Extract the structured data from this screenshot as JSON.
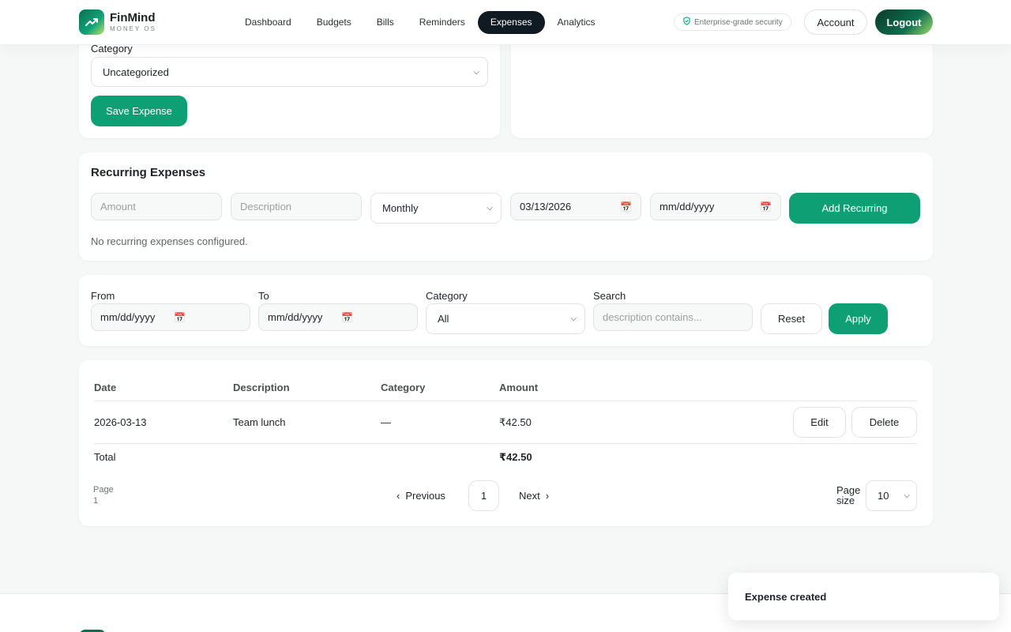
{
  "brand": {
    "name": "FinMind",
    "tagline": "MONEY OS"
  },
  "nav": {
    "items": [
      "Dashboard",
      "Budgets",
      "Bills",
      "Reminders",
      "Expenses",
      "Analytics"
    ],
    "active": "Expenses"
  },
  "header": {
    "security_badge": "Enterprise-grade security",
    "account_label": "Account",
    "logout_label": "Logout"
  },
  "expense_form": {
    "category_label": "Category",
    "category_value": "Uncategorized",
    "save_label": "Save Expense"
  },
  "recurring": {
    "title": "Recurring Expenses",
    "amount_placeholder": "Amount",
    "description_placeholder": "Description",
    "frequency_value": "Monthly",
    "start_date_value": "03/13/2026",
    "end_date_placeholder": "mm/dd/yyyy",
    "add_label": "Add Recurring",
    "empty_text": "No recurring expenses configured."
  },
  "filters": {
    "from_label": "From",
    "from_placeholder": "mm/dd/yyyy",
    "to_label": "To",
    "to_placeholder": "mm/dd/yyyy",
    "category_label": "Category",
    "category_value": "All",
    "search_label": "Search",
    "search_placeholder": "description contains...",
    "reset_label": "Reset",
    "apply_label": "Apply"
  },
  "table": {
    "headers": [
      "Date",
      "Description",
      "Category",
      "Amount"
    ],
    "rows": [
      {
        "date": "2026-03-13",
        "description": "Team lunch",
        "category": "—",
        "amount": "₹42.50",
        "edit_label": "Edit",
        "delete_label": "Delete"
      }
    ],
    "total_label": "Total",
    "total_value": "₹42.50"
  },
  "pagination": {
    "page_label": "Page",
    "page_value": "1",
    "previous_label": "Previous",
    "current_page": "1",
    "next_label": "Next",
    "page_size_label_1": "Page",
    "page_size_label_2": "size",
    "page_size_value": "10"
  },
  "toast": {
    "message": "Expense created"
  },
  "colors": {
    "accent": "#0f9f74",
    "nav_active": "#0f1a22"
  },
  "icons": [
    "trend-up-icon",
    "shield-check-icon",
    "chevron-down-icon",
    "calendar-icon",
    "chevron-left-icon",
    "chevron-right-icon"
  ]
}
